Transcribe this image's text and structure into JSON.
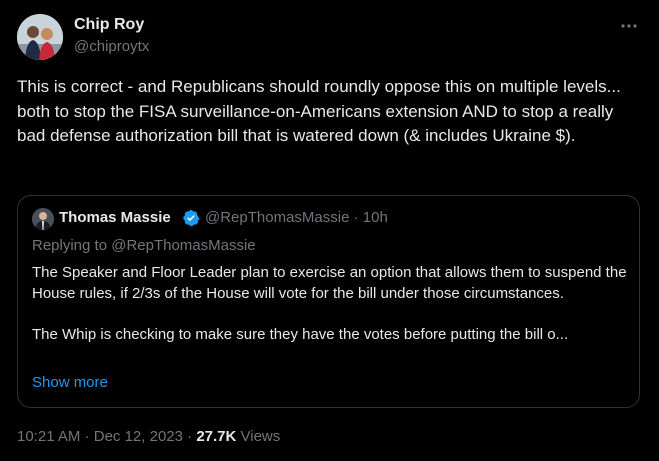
{
  "tweet": {
    "author_name": "Chip Roy",
    "author_handle": "@chiproytx",
    "more_icon": "more-dots-icon",
    "text": "This is correct - and Republicans should roundly oppose this on multiple levels... both to stop the FISA surveillance-on-Americans extension AND to stop a really bad defense authorization bill that is watered down (& includes Ukraine $).",
    "time": "10:21 AM",
    "date": "Dec 12, 2023",
    "views_count": "27.7K",
    "views_label": "Views"
  },
  "quote": {
    "author_name": "Thomas Massie",
    "verified_icon": "verified-badge-icon",
    "verified_color": "#1d9bf0",
    "handle_time": "@RepThomasMassie · 10h",
    "replying_to": "Replying to @RepThomasMassie",
    "paragraph1": "The Speaker and Floor Leader plan to exercise an option that allows them to suspend the House rules, if 2/3s of the House will vote for the bill under those circumstances.",
    "paragraph2": "The Whip is checking to make sure they have the votes before putting the bill o...",
    "show_more": "Show more"
  }
}
